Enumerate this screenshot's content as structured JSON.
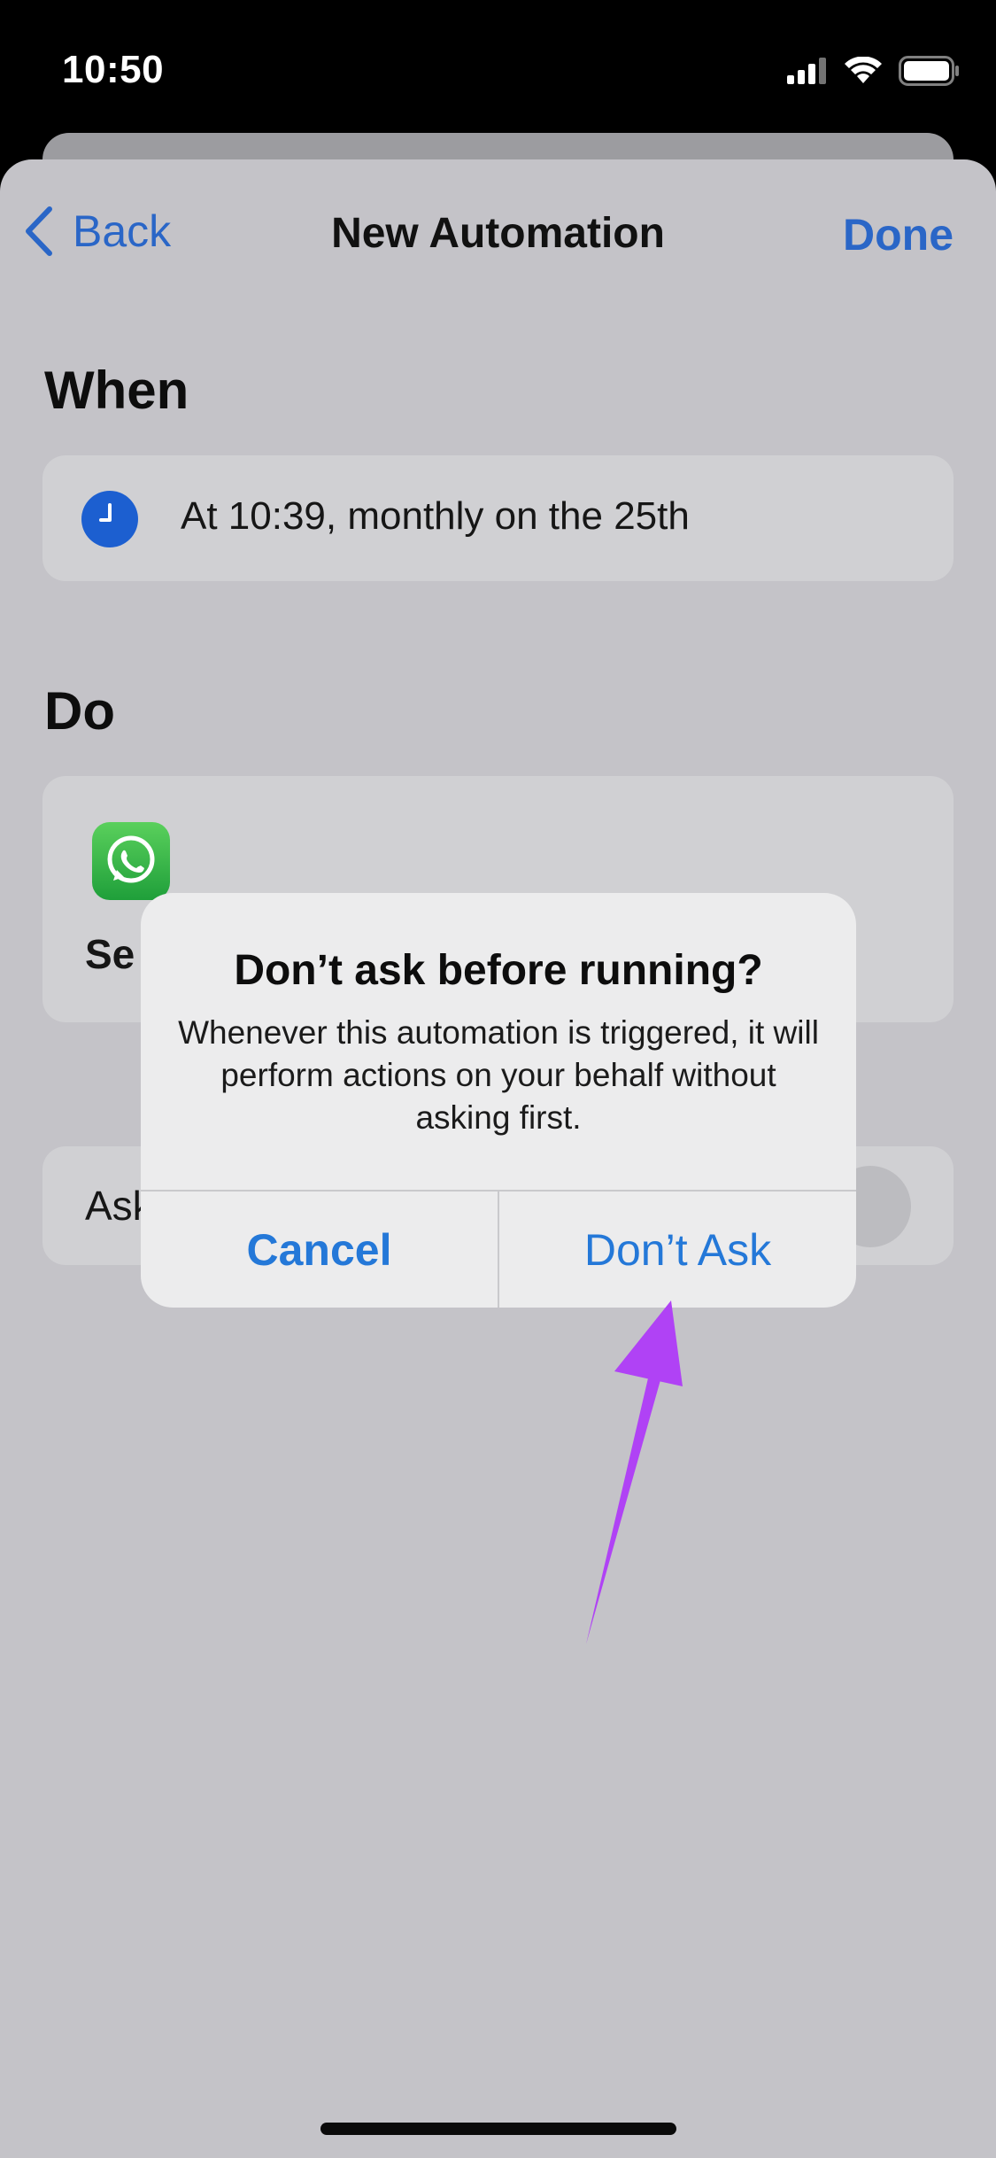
{
  "status_bar": {
    "time": "10:50"
  },
  "nav": {
    "back_label": "Back",
    "title": "New Automation",
    "done_label": "Done"
  },
  "when": {
    "section_title": "When",
    "trigger_text": "At 10:39, monthly on the 25th"
  },
  "do": {
    "section_title": "Do",
    "action_label": "Se"
  },
  "ask": {
    "label": "Ask"
  },
  "alert": {
    "title": "Don’t ask before running?",
    "message": "Whenever this automation is triggered, it will perform actions on your behalf without asking first.",
    "cancel_label": "Cancel",
    "confirm_label": "Don’t Ask"
  },
  "colors": {
    "accent": "#2a66c7",
    "alert_button": "#2478d8",
    "annotation_arrow": "#b042f5",
    "whatsapp_green": "#2fb04a"
  },
  "icons": [
    "signal-icon",
    "wifi-icon",
    "battery-icon",
    "chevron-left-icon",
    "clock-icon",
    "whatsapp-icon",
    "annotation-arrow"
  ]
}
